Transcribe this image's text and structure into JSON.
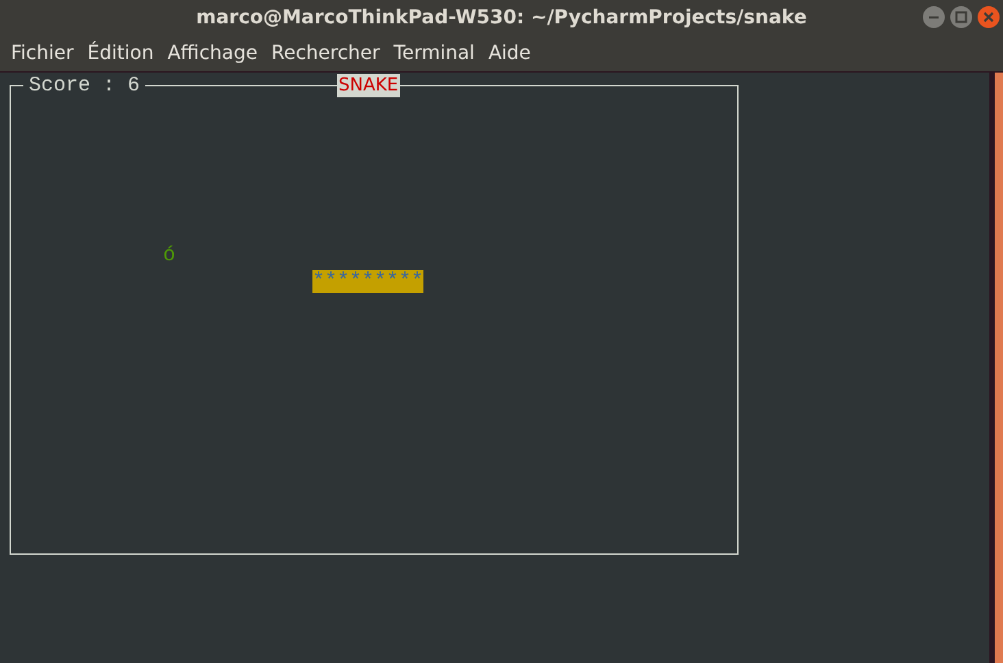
{
  "window": {
    "title": "marco@MarcoThinkPad-W530: ~/PycharmProjects/snake"
  },
  "menu": [
    "Fichier",
    "Édition",
    "Affichage",
    "Rechercher",
    "Terminal",
    "Aide"
  ],
  "game": {
    "score_label": "Score : 6",
    "title": "SNAKE",
    "food": "ó",
    "snake": "*********"
  }
}
